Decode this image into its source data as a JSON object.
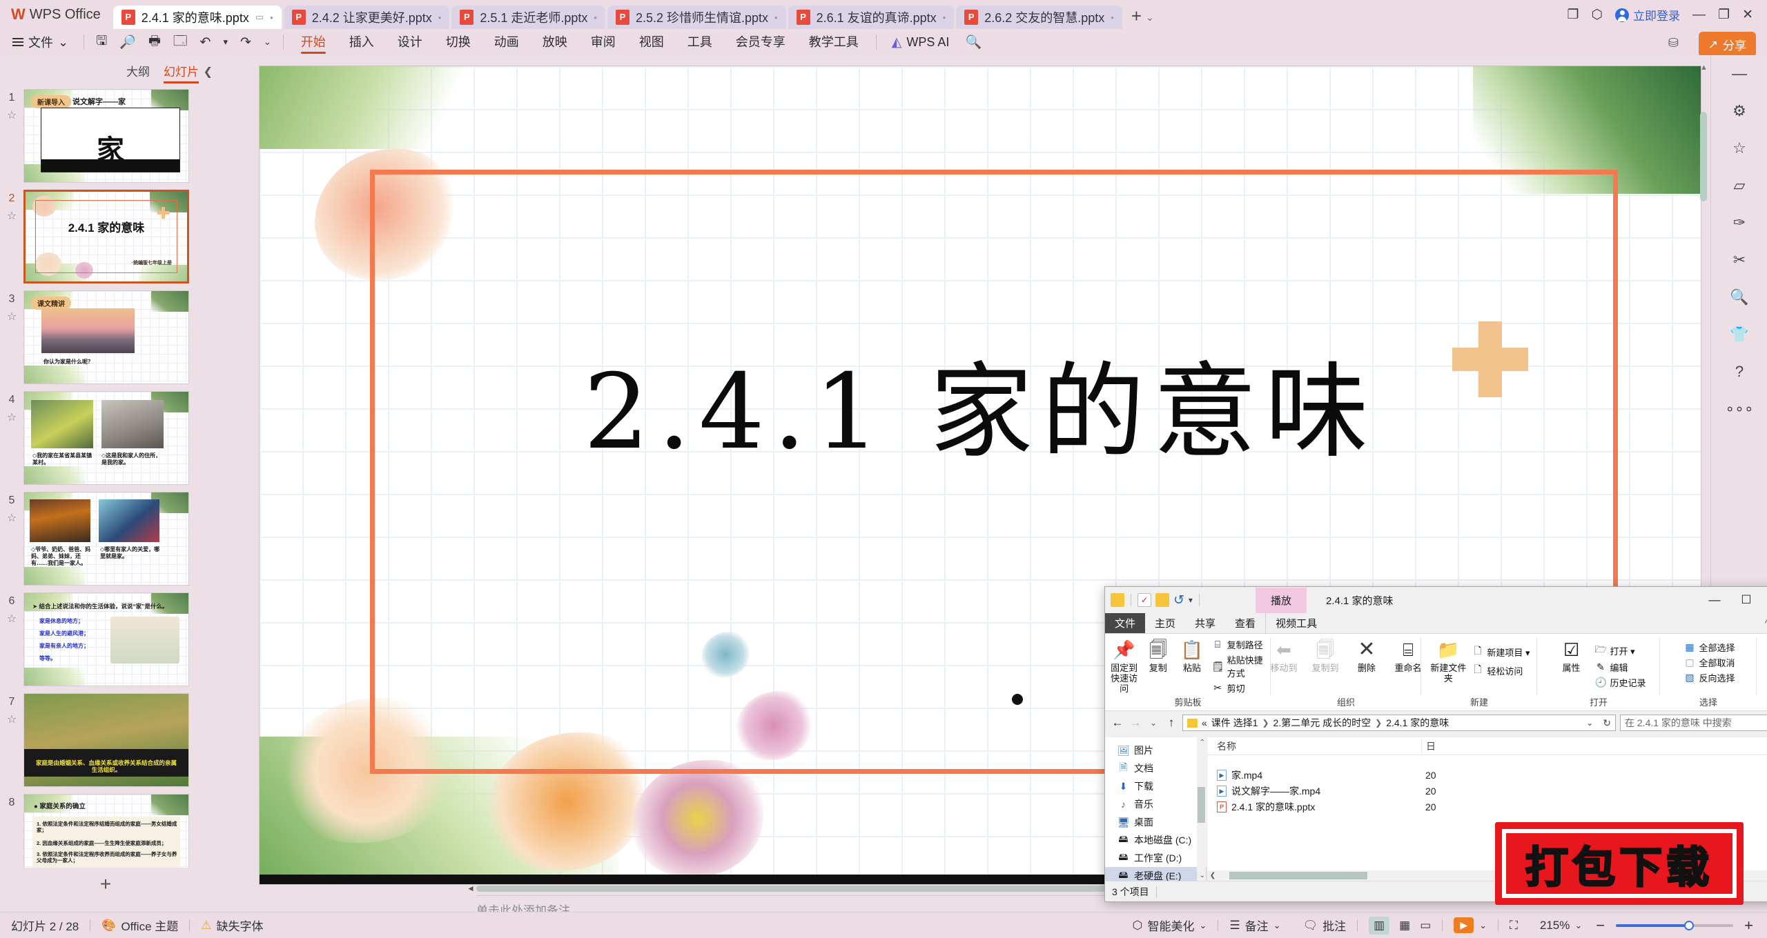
{
  "app": {
    "name": "WPS Office",
    "logo_glyph": "W"
  },
  "tabs": [
    {
      "label": "2.4.1 家的意味.pptx",
      "active": true,
      "icon": "powerpoint-icon"
    },
    {
      "label": "2.4.2 让家更美好.pptx",
      "active": false,
      "icon": "powerpoint-icon"
    },
    {
      "label": "2.5.1 走近老师.pptx",
      "active": false,
      "icon": "powerpoint-icon"
    },
    {
      "label": "2.5.2 珍惜师生情谊.pptx",
      "active": false,
      "icon": "powerpoint-icon"
    },
    {
      "label": "2.6.1 友谊的真谛.pptx",
      "active": false,
      "icon": "powerpoint-icon"
    },
    {
      "label": "2.6.2 交友的智慧.pptx",
      "active": false,
      "icon": "powerpoint-icon"
    }
  ],
  "tabbar": {
    "add_tab": "+",
    "add_tab_caret": "⌄",
    "screen_icon": "monitor-icon",
    "login_label": "立即登录",
    "minimize": "—",
    "restore": "❐",
    "close": "✕"
  },
  "ribbon": {
    "file_menu": "文件",
    "file_caret": "⌄",
    "quick_icons": [
      "save-icon",
      "search-doc-icon",
      "print-icon",
      "print-preview-icon",
      "undo-icon",
      "redo-icon",
      "more-caret-icon"
    ],
    "tabs": [
      {
        "label": "开始",
        "active": true
      },
      {
        "label": "插入",
        "active": false
      },
      {
        "label": "设计",
        "active": false
      },
      {
        "label": "切换",
        "active": false
      },
      {
        "label": "动画",
        "active": false
      },
      {
        "label": "放映",
        "active": false
      },
      {
        "label": "审阅",
        "active": false
      },
      {
        "label": "视图",
        "active": false
      },
      {
        "label": "工具",
        "active": false
      },
      {
        "label": "会员专享",
        "active": false
      },
      {
        "label": "教学工具",
        "active": false
      }
    ],
    "ai_label": "WPS AI",
    "search_icon": "search-icon",
    "share_label": "分享",
    "cloud_icon": "cloud-upload-icon"
  },
  "thumbpanel": {
    "tab_outline": "大纲",
    "tab_slides": "幻灯片",
    "collapse_icon": "collapse-panel-icon",
    "add_slide": "+",
    "slides": [
      {
        "num": "1",
        "selected": false,
        "badge": "新课导入",
        "title": "说文解字——家",
        "han": "家"
      },
      {
        "num": "2",
        "selected": true,
        "title": "2.4.1  家的意味",
        "sub": "·统编版七年级上册"
      },
      {
        "num": "3",
        "selected": false,
        "badge": "课文精讲",
        "caption": "你认为家是什么呢？"
      },
      {
        "num": "4",
        "selected": false,
        "cap_left": "◇我的家在某省某县某镇某村。",
        "cap_right": "◇这是我和家人的住所，是我的家。"
      },
      {
        "num": "5",
        "selected": false,
        "cap_left": "◇爷爷、奶奶、爸爸、妈妈、弟弟、妹妹，还有……我们是一家人。",
        "cap_right": "◇哪里有家人的关爱，哪里就是家。"
      },
      {
        "num": "6",
        "selected": false,
        "heading": "➤ 结合上述说法和你的生活体验，说说“家”是什么。",
        "lines": [
          "家是休息的地方；",
          "家是人生的避风港；",
          "家是有亲人的地方；",
          "等等。"
        ]
      },
      {
        "num": "7",
        "selected": false,
        "caption": "家庭是由婚姻关系、血缘关系或收养关系结合成的亲属生活组织。"
      },
      {
        "num": "8",
        "selected": false,
        "heading": "● 家庭关系的确立",
        "lines": [
          "1. 依照法定条件和法定程序结婚而组成的家庭——男女结婚成家；",
          "2. 因血缘关系组成的家庭——生生降生使家庭添新成员；",
          "3. 依照法定条件和法定程序收养而组成的家庭——养子女与养父母成为一家人；"
        ]
      }
    ]
  },
  "slide": {
    "title": "2.4.1  家的意味",
    "star_icon": "star-icon"
  },
  "notes": {
    "placeholder": "单击此处添加备注",
    "splitter_arrow": "◄"
  },
  "rightbar": {
    "items": [
      {
        "icon": "collapse-icon",
        "glyph": "—"
      },
      {
        "icon": "settings-slider-icon",
        "glyph": "⚙"
      },
      {
        "icon": "star-icon",
        "glyph": "☆"
      },
      {
        "icon": "shape-icon",
        "glyph": "▱"
      },
      {
        "icon": "feather-icon",
        "glyph": "✑"
      },
      {
        "icon": "tools-icon",
        "glyph": "✂"
      },
      {
        "icon": "search-doc-icon",
        "glyph": "🔍"
      },
      {
        "icon": "theme-icon",
        "glyph": "👕"
      },
      {
        "icon": "help-icon",
        "glyph": "?"
      },
      {
        "icon": "more-icon",
        "glyph": "∘∘∘"
      }
    ]
  },
  "statusbar": {
    "slide_counter": "幻灯片 2 / 28",
    "theme_icon": "theme-icon",
    "theme_label": "Office 主题",
    "warn_icon": "warning-icon",
    "warn_label": "缺失字体",
    "beautify_icon": "beautify-icon",
    "beautify_label": "智能美化",
    "beautify_caret": "⌄",
    "notes_icon": "notes-icon",
    "notes_label": "备注",
    "notes_caret": "⌄",
    "comment_icon": "comment-icon",
    "comment_label": "批注",
    "view_normal_icon": "normal-view-icon",
    "view_sorter_icon": "slide-sorter-icon",
    "view_reading_icon": "reading-view-icon",
    "play_icon": "play-icon",
    "play_caret": "⌄",
    "fit_icon": "fit-to-window-icon",
    "zoom_level": "215%",
    "zoom_caret": "⌄",
    "zoom_out": "−",
    "zoom_in": "+"
  },
  "explorer": {
    "quick_access_icons": [
      "folder-icon",
      "checklist-icon",
      "folder-icon",
      "undo-icon",
      "customize-caret-icon"
    ],
    "context_tab": "播放",
    "window_title": "2.4.1 家的意味",
    "window_buttons": {
      "minimize": "—",
      "maximize": "☐",
      "close": "✕"
    },
    "tabs": [
      {
        "label": "文件",
        "style": "file"
      },
      {
        "label": "主页",
        "style": "normal"
      },
      {
        "label": "共享",
        "style": "normal"
      },
      {
        "label": "查看",
        "style": "normal"
      },
      {
        "label": "视频工具",
        "style": "vid"
      }
    ],
    "collapse_caret": "^",
    "help_glyph": "?",
    "ribbon_groups": [
      {
        "name": "剪贴板",
        "big": [
          {
            "label": "固定到快速访问",
            "glyph": "📌",
            "icon": "pin-icon"
          },
          {
            "label": "复制",
            "glyph": "🗐",
            "icon": "copy-icon"
          },
          {
            "label": "粘贴",
            "glyph": "📋",
            "icon": "paste-icon"
          }
        ],
        "small": [
          {
            "label": "复制路径",
            "glyph": "⌸",
            "icon": "copy-path-icon"
          },
          {
            "label": "粘贴快捷方式",
            "glyph": "🗒",
            "icon": "paste-shortcut-icon"
          },
          {
            "label": "剪切",
            "glyph": "✂",
            "icon": "cut-icon"
          }
        ]
      },
      {
        "name": "组织",
        "big": [
          {
            "label": "移动到",
            "glyph": "⬅",
            "icon": "move-to-icon"
          },
          {
            "label": "复制到",
            "glyph": "🗐",
            "icon": "copy-to-icon"
          },
          {
            "label": "删除",
            "glyph": "✕",
            "icon": "delete-icon"
          },
          {
            "label": "重命名",
            "glyph": "⌸",
            "icon": "rename-icon"
          }
        ],
        "small": []
      },
      {
        "name": "新建",
        "big": [
          {
            "label": "新建文件夹",
            "glyph": "📁",
            "icon": "new-folder-icon"
          }
        ],
        "small": [
          {
            "label": "新建项目 ▾",
            "glyph": "🗋",
            "icon": "new-item-icon"
          },
          {
            "label": "轻松访问",
            "glyph": "🗋",
            "icon": "easy-access-icon"
          }
        ]
      },
      {
        "name": "打开",
        "big": [
          {
            "label": "属性",
            "glyph": "☑",
            "icon": "properties-icon"
          }
        ],
        "small": [
          {
            "label": "打开 ▾",
            "glyph": "🗁",
            "icon": "open-icon"
          },
          {
            "label": "编辑",
            "glyph": "✎",
            "icon": "edit-icon"
          },
          {
            "label": "历史记录",
            "glyph": "🕘",
            "icon": "history-icon"
          }
        ]
      },
      {
        "name": "选择",
        "big": [],
        "small": [
          {
            "label": "全部选择",
            "glyph": "▦",
            "icon": "select-all-icon"
          },
          {
            "label": "全部取消",
            "glyph": "▢",
            "icon": "select-none-icon"
          },
          {
            "label": "反向选择",
            "glyph": "▧",
            "icon": "invert-selection-icon"
          }
        ]
      }
    ],
    "nav": {
      "back": "←",
      "forward": "→",
      "recent": "⌄",
      "up": "↑"
    },
    "breadcrumb": [
      "«",
      "课件 选择1",
      "2.第二单元 成长的时空",
      "2.4.1 家的意味"
    ],
    "address_caret": "⌄",
    "refresh": "↻",
    "search_placeholder": "在 2.4.1 家的意味 中搜索",
    "search_icon": "search-icon",
    "nav_pane": [
      {
        "label": "图片",
        "icon": "pictures-icon",
        "glyph": "🖼",
        "selected": false
      },
      {
        "label": "文档",
        "icon": "documents-icon",
        "glyph": "🗎",
        "selected": false
      },
      {
        "label": "下载",
        "icon": "downloads-icon",
        "glyph": "⬇",
        "selected": false
      },
      {
        "label": "音乐",
        "icon": "music-icon",
        "glyph": "♪",
        "selected": false
      },
      {
        "label": "桌面",
        "icon": "desktop-icon",
        "glyph": "🖥",
        "selected": false
      },
      {
        "label": "本地磁盘 (C:)",
        "icon": "drive-icon",
        "glyph": "🖴",
        "selected": false
      },
      {
        "label": "工作室 (D:)",
        "icon": "drive-icon",
        "glyph": "🖴",
        "selected": false
      },
      {
        "label": "老硬盘 (E:)",
        "icon": "drive-icon",
        "glyph": "🖴",
        "selected": true
      }
    ],
    "columns": {
      "name": "名称",
      "date": "日"
    },
    "files": [
      {
        "name": "家.mp4",
        "type": "mp4",
        "date": "20"
      },
      {
        "name": "说文解字——家.mp4",
        "type": "mp4",
        "date": "20"
      },
      {
        "name": "2.4.1 家的意味.pptx",
        "type": "pptx",
        "date": "20"
      }
    ],
    "status": "3 个项目"
  },
  "watermark": {
    "text": "打包下载"
  }
}
